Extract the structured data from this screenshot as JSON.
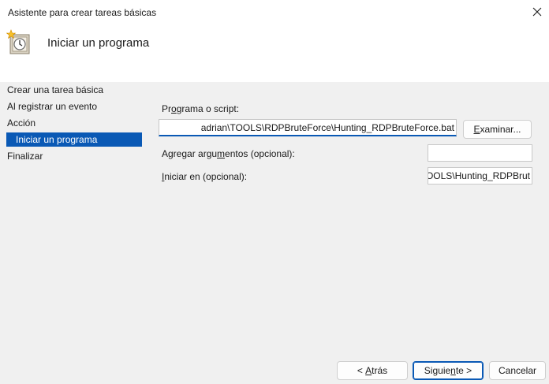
{
  "window": {
    "title": "Asistente para crear tareas básicas",
    "close_icon": "close-icon"
  },
  "header": {
    "title": "Iniciar un programa",
    "icon": "task-clock-icon"
  },
  "nav": {
    "items": [
      {
        "label": "Crear una tarea básica",
        "selected": false
      },
      {
        "label": "Al registrar un evento",
        "selected": false
      },
      {
        "label": "Acción",
        "selected": false
      },
      {
        "label": "Iniciar un programa",
        "selected": true
      },
      {
        "label": "Finalizar",
        "selected": false
      }
    ]
  },
  "form": {
    "program_label_pre": "Pr",
    "program_label_u": "o",
    "program_label_post": "grama o script:",
    "program_value": "adrian\\TOOLS\\RDPBruteForce\\Hunting_RDPBruteForce.bat",
    "browse_pre": "",
    "browse_u": "E",
    "browse_post": "xaminar...",
    "args_label_pre": "Agregar argu",
    "args_label_u": "m",
    "args_label_post": "entos (opcional):",
    "args_value": "",
    "start_label_pre": "",
    "start_label_u": "I",
    "start_label_post": "niciar en (opcional):",
    "start_value": "TOOLS\\Hunting_RDPBrut"
  },
  "footer": {
    "back_pre": "< ",
    "back_u": "A",
    "back_post": "trás",
    "next_pre": "Siguie",
    "next_u": "n",
    "next_post": "te >",
    "cancel": "Cancelar"
  }
}
